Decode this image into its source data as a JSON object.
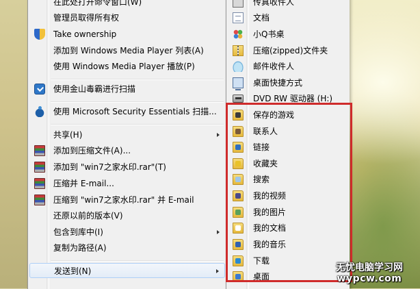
{
  "context_menu": {
    "items": [
      {
        "label": "在此处打开命令窗口(W)",
        "icon": "",
        "submenu": false
      },
      {
        "label": "管理员取得所有权",
        "icon": "",
        "submenu": false
      },
      {
        "label": "Take ownership",
        "icon": "shield-icon",
        "submenu": false
      },
      {
        "label": "添加到 Windows Media Player 列表(A)",
        "icon": "",
        "submenu": false
      },
      {
        "label": "使用 Windows Media Player 播放(P)",
        "icon": "",
        "submenu": false
      },
      {
        "label": "使用金山毒霸进行扫描",
        "icon": "jinshan-antivirus-icon",
        "submenu": false
      },
      {
        "label": "使用 Microsoft Security Essentials 扫描...",
        "icon": "microsoft-security-essentials-icon",
        "submenu": false
      },
      {
        "label": "共享(H)",
        "icon": "",
        "submenu": true
      },
      {
        "label": "添加到压缩文件(A)...",
        "icon": "winrar-icon",
        "submenu": false
      },
      {
        "label": "添加到 \"win7之家水印.rar\"(T)",
        "icon": "winrar-icon",
        "submenu": false
      },
      {
        "label": "压缩并 E-mail...",
        "icon": "winrar-icon",
        "submenu": false
      },
      {
        "label": "压缩到 \"win7之家水印.rar\" 并 E-mail",
        "icon": "winrar-icon",
        "submenu": false
      },
      {
        "label": "还原以前的版本(V)",
        "icon": "",
        "submenu": false
      },
      {
        "label": "包含到库中(I)",
        "icon": "",
        "submenu": true
      },
      {
        "label": "复制为路径(A)",
        "icon": "",
        "submenu": false
      },
      {
        "label": "发送到(N)",
        "icon": "",
        "submenu": true,
        "hovered": true
      }
    ]
  },
  "send_to_submenu": {
    "items": [
      {
        "label": "传真收件人",
        "icon": "fax-icon"
      },
      {
        "label": "文档",
        "icon": "document-icon"
      },
      {
        "label": "小Q书桌",
        "icon": "xiaoq-desk-icon"
      },
      {
        "label": "压缩(zipped)文件夹",
        "icon": "zip-folder-icon"
      },
      {
        "label": "邮件收件人",
        "icon": "mail-recipient-icon"
      },
      {
        "label": "桌面快捷方式",
        "icon": "desktop-shortcut-icon"
      },
      {
        "label": "DVD RW 驱动器 (H:)",
        "icon": "dvd-drive-icon"
      },
      {
        "label": "保存的游戏",
        "icon": "saved-games-folder-icon"
      },
      {
        "label": "联系人",
        "icon": "contacts-folder-icon"
      },
      {
        "label": "链接",
        "icon": "links-folder-icon"
      },
      {
        "label": "收藏夹",
        "icon": "favorites-folder-icon"
      },
      {
        "label": "搜索",
        "icon": "searches-folder-icon"
      },
      {
        "label": "我的视频",
        "icon": "my-videos-folder-icon"
      },
      {
        "label": "我的图片",
        "icon": "my-pictures-folder-icon"
      },
      {
        "label": "我的文档",
        "icon": "my-documents-folder-icon"
      },
      {
        "label": "我的音乐",
        "icon": "my-music-folder-icon"
      },
      {
        "label": "下载",
        "icon": "downloads-folder-icon"
      },
      {
        "label": "桌面",
        "icon": "desktop-folder-icon"
      }
    ]
  },
  "highlight_color": "#cf2b2b",
  "watermark": {
    "line1": "无忧电脑学习网",
    "line2": "wypcw.com"
  }
}
